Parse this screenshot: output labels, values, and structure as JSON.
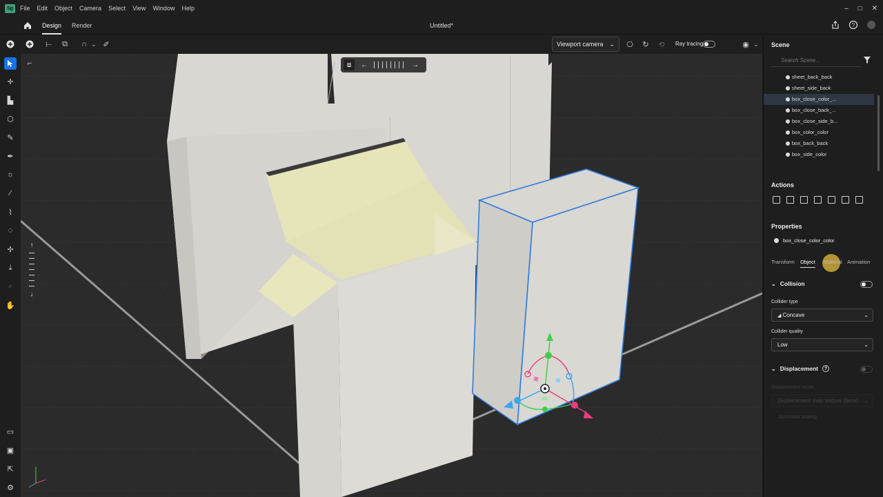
{
  "app": {
    "logo_text": "Sg",
    "menu": [
      "File",
      "Edit",
      "Object",
      "Camera",
      "Select",
      "View",
      "Window",
      "Help"
    ],
    "window_controls": [
      "–",
      "□",
      "✕"
    ]
  },
  "tabs": {
    "design": "Design",
    "render": "Render",
    "document_title": "Untitled*"
  },
  "viewport": {
    "camera_label": "Viewport camera",
    "ray_tracing_label": "Ray tracing",
    "ray_tracing_on": false
  },
  "scene": {
    "title": "Scene",
    "search_placeholder": "Search Scene...",
    "items": [
      {
        "label": "sheet_back_back",
        "selected": false
      },
      {
        "label": "sheet_side_back",
        "selected": false
      },
      {
        "label": "box_close_color_...",
        "selected": true
      },
      {
        "label": "box_close_back_...",
        "selected": false
      },
      {
        "label": "box_close_side_b...",
        "selected": false
      },
      {
        "label": "box_color_color",
        "selected": false
      },
      {
        "label": "box_back_back",
        "selected": false
      },
      {
        "label": "box_side_color",
        "selected": false
      }
    ]
  },
  "actions": {
    "title": "Actions",
    "icons": [
      "delete-icon",
      "duplicate-icon",
      "group-icon",
      "export-icon",
      "mirror-icon",
      "swap-icon",
      "frame-icon"
    ]
  },
  "properties": {
    "title": "Properties",
    "object_name": "box_close_color_color",
    "tabs": [
      "Transform",
      "Object",
      "Material",
      "Animation"
    ],
    "active_tab": "Object",
    "collision": {
      "label": "Collision",
      "enabled": false,
      "collider_type_label": "Collider type",
      "collider_type_value": "Concave",
      "collider_quality_label": "Collider quality",
      "collider_quality_value": "Low"
    },
    "displacement": {
      "label": "Displacement",
      "help": "?",
      "mode_label": "Displacement mode",
      "mode_value": "Displacement map texture (Beta)",
      "automatic_scaling_label": "Automatic scaling"
    }
  }
}
